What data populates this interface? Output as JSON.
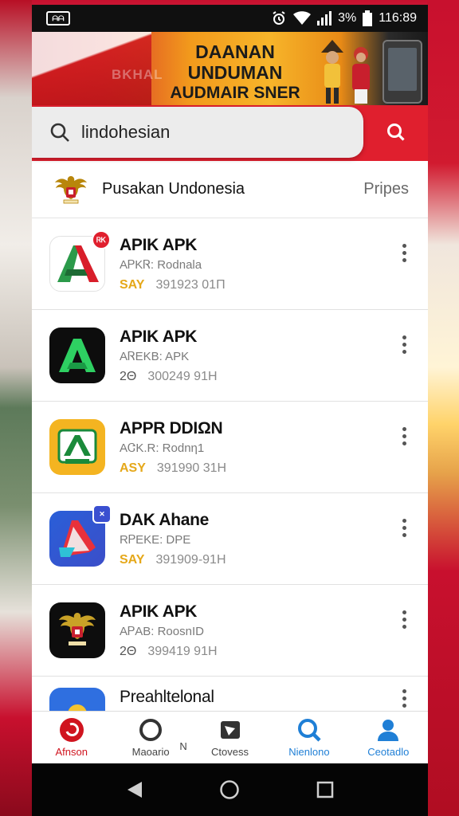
{
  "status_bar": {
    "notif_text": "ᗩᗩ",
    "battery_text": "3%",
    "time": "116:89"
  },
  "banner": {
    "ghost_text": "BKHAL",
    "title_line1": "DAANAN UNDUMAN",
    "title_line2": "AUDMAIR SNER H168"
  },
  "search": {
    "query": "lindohesian"
  },
  "header": {
    "title": "Pusakan Undonesia",
    "link": "Pripes"
  },
  "apps": [
    {
      "name": "APIK APK",
      "sub": "AᏢKᏒ: Rodnala",
      "tag": "SAY",
      "meta": "391923 01Π",
      "badge": "ᏒᏦ"
    },
    {
      "name": "APIK APK",
      "sub": "AᏒEKB: APK",
      "tag": "2Θ",
      "meta": "300249 91H",
      "badge": ""
    },
    {
      "name": "APPR DDIΩN",
      "sub": "AᏣK.R: Rodnη1",
      "tag": "ASY",
      "meta": "391990 31H",
      "badge": ""
    },
    {
      "name": "DAK Ahane",
      "sub": "RᏢEKE: DPE",
      "tag": "SAY",
      "meta": "391909-91H",
      "badge": "✕"
    },
    {
      "name": "APIK APK",
      "sub": "AᏢAB: RoosnID",
      "tag": "2Θ",
      "meta": "399419 91H",
      "badge": ""
    },
    {
      "name": "Preahltelonal",
      "sub": "",
      "tag": "",
      "meta": "",
      "badge": ""
    }
  ],
  "bottom_nav": [
    {
      "label": "Afnson",
      "icon": "home-icon"
    },
    {
      "label": "Maoario",
      "icon": "circle-icon"
    },
    {
      "label": "Ctovess",
      "icon": "tablet-icon"
    },
    {
      "label": "Nienlono",
      "icon": "search-icon"
    },
    {
      "label": "Ceotadlo",
      "icon": "profile-icon"
    }
  ],
  "bottom_nav_extra": "N",
  "colors": {
    "accent_red": "#e01f2e",
    "nav_blue": "#1f7fd6",
    "tag_yellow": "#e5a81a"
  }
}
